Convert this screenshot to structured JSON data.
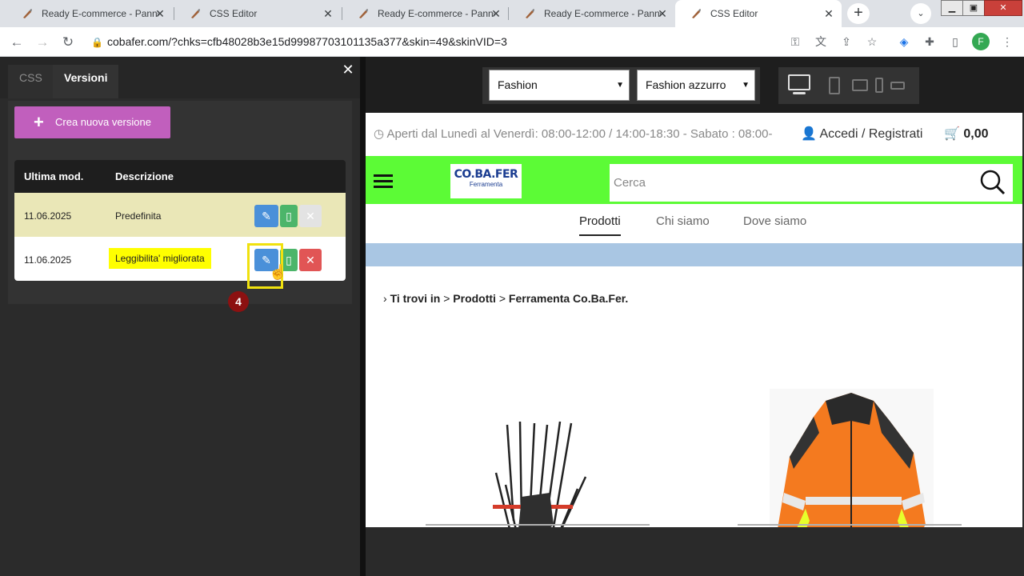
{
  "browser": {
    "tabs": [
      {
        "title": "Ready E-commerce - Pannello",
        "active": false
      },
      {
        "title": "CSS Editor",
        "active": false
      },
      {
        "title": "Ready E-commerce - Pannello",
        "active": false
      },
      {
        "title": "Ready E-commerce - Pannello",
        "active": false
      },
      {
        "title": "CSS Editor",
        "active": true
      }
    ],
    "url": "cobafer.com/?chks=cfb48028b3e15d99987703101135a377&skin=49&skinVID=3",
    "profile_initial": "F"
  },
  "editor": {
    "tabs": {
      "css": "CSS",
      "versioni": "Versioni"
    },
    "new_version_label": "Crea nuova versione",
    "table": {
      "headers": {
        "date": "Ultima mod.",
        "description": "Descrizione"
      },
      "rows": [
        {
          "date": "11.06.2025",
          "description": "Predefinita"
        },
        {
          "date": "11.06.2025",
          "description": "Leggibilita' migliorata"
        }
      ]
    },
    "step_badge": "4"
  },
  "preview": {
    "skin": "Fashion",
    "variant": "Fashion azzurro",
    "site": {
      "hours": "Aperti dal Lunedì al Venerdì: 08:00-12:00 / 14:00-18:30 - Sabato : 08:00-",
      "login": "Accedi / Registrati",
      "cart_total": "0,00",
      "logo_main": "CO.BA.FER",
      "logo_sub": "Ferramenta",
      "search_placeholder": "Cerca",
      "nav": [
        "Prodotti",
        "Chi siamo",
        "Dove siamo"
      ],
      "breadcrumb": {
        "prefix": "Ti trovi in",
        "level1": "Prodotti",
        "level2": "Ferramenta Co.Ba.Fer."
      }
    }
  },
  "colors": {
    "accent_purple": "#c15fbd",
    "site_header_green": "#5cfb36",
    "highlight": "#f0e10f"
  }
}
